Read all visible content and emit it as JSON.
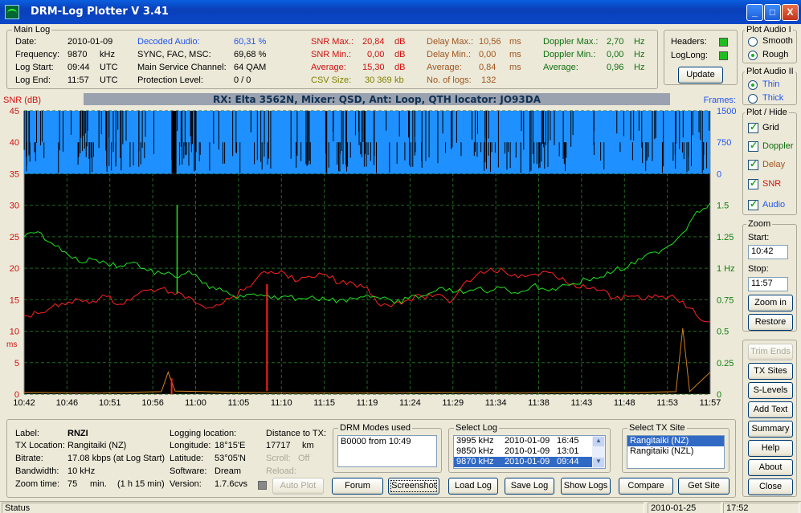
{
  "window": {
    "title": "DRM-Log Plotter  V 3.41",
    "min": "_",
    "max": "□",
    "close": "X"
  },
  "main_log": {
    "title": "Main Log",
    "date_label": "Date:",
    "date": "2010-01-09",
    "freq_label": "Frequency:",
    "freq": "9870",
    "freq_unit": "kHz",
    "start_label": "Log Start:",
    "start": "09:44",
    "start_unit": "UTC",
    "end_label": "Log End:",
    "end": "11:57",
    "end_unit": "UTC",
    "decoded_label": "Decoded Audio:",
    "decoded": "60,31 %",
    "sync_label": "SYNC, FAC, MSC:",
    "sync": "69,68 %",
    "msc_label": "Main Service Channel:",
    "msc": "64  QAM",
    "prot_label": "Protection Level:",
    "prot": "0 / 0",
    "snrmax_label": "SNR Max.:",
    "snrmax": "20,84",
    "snrmax_unit": "dB",
    "snrmin_label": "SNR Min.:",
    "snrmin": "0,00",
    "snrmin_unit": "dB",
    "snravg_label": "Average:",
    "snravg": "15,30",
    "snravg_unit": "dB",
    "csv_label": "CSV Size:",
    "csv": "30 369",
    "csv_unit": "kb",
    "dmax_label": "Delay Max.:",
    "dmax": "10,56",
    "dmax_unit": "ms",
    "dmin_label": "Delay Min.:",
    "dmin": "0,00",
    "dmin_unit": "ms",
    "davg_label": "Average:",
    "davg": "0,84",
    "davg_unit": "ms",
    "nlogs_label": "No. of logs:",
    "nlogs": "132",
    "domax_label": "Doppler Max.:",
    "domax": "2,70",
    "domax_unit": "Hz",
    "domin_label": "Doppler Min.:",
    "domin": "0,00",
    "domin_unit": "Hz",
    "doavg_label": "Average:",
    "doavg": "0,96",
    "doavg_unit": "Hz"
  },
  "headers_box": {
    "headers_label": "Headers:",
    "loglong_label": "LogLong:",
    "update": "Update"
  },
  "plot_audio1": {
    "title": "Plot Audio I",
    "smooth": "Smooth",
    "rough": "Rough"
  },
  "plot_audio2": {
    "title": "Plot Audio II",
    "thin": "Thin",
    "thick": "Thick"
  },
  "plot_hide": {
    "title": "Plot / Hide",
    "grid": "Grid",
    "doppler": "Doppler",
    "delay": "Delay",
    "snr": "SNR",
    "audio": "Audio"
  },
  "zoom": {
    "title": "Zoom",
    "start_label": "Start:",
    "start": "10:42",
    "stop_label": "Stop:",
    "stop": "11:57",
    "zoom_in": "Zoom in",
    "restore": "Restore"
  },
  "side_buttons": {
    "trim": "Trim Ends",
    "tx_sites": "TX Sites",
    "s_levels": "S-Levels",
    "add_text": "Add Text",
    "summary": "Summary",
    "help": "Help",
    "about": "About",
    "close": "Close"
  },
  "chart_data": {
    "type": "line",
    "title": "RX: Elta 3562N, Mixer: QSD,  Ant: Loop, QTH locator: JO93DA",
    "left_axis_label": "SNR (dB)",
    "left_axis_label2": "ms",
    "right_axis_label": "Frames:",
    "x_ticks": [
      "10:42",
      "10:46",
      "10:51",
      "10:56",
      "11:00",
      "11:05",
      "11:10",
      "11:15",
      "11:19",
      "11:24",
      "11:29",
      "11:34",
      "11:38",
      "11:43",
      "11:48",
      "11:53",
      "11:57"
    ],
    "y_ticks_left": [
      "45",
      "40",
      "35",
      "30",
      "25",
      "20",
      "15",
      "10",
      "5",
      "0"
    ],
    "frames_ticks": [
      "1500",
      "750",
      "0"
    ],
    "doppler_ticks": [
      "1.5",
      "1.25",
      "1 Hz",
      "0.75",
      "0.5",
      "0.25",
      "0"
    ],
    "ylim": [
      0,
      45
    ],
    "grid": true,
    "series": [
      {
        "kind": "snr",
        "color": "#ff2020",
        "x": [
          0,
          2,
          4,
          6,
          8,
          10,
          12,
          14,
          16,
          18,
          20,
          22,
          24,
          26,
          28,
          30,
          32,
          34,
          36,
          38,
          40,
          42,
          44,
          46,
          48,
          50,
          52,
          54,
          56,
          58,
          60,
          62,
          64,
          66,
          68,
          70,
          72,
          74,
          76,
          78,
          80,
          82,
          84,
          86,
          88,
          90,
          92,
          94,
          96,
          98,
          100
        ],
        "y": [
          12.5,
          12.8,
          13.8,
          14.2,
          15.0,
          14.8,
          15.5,
          14.3,
          15.5,
          16.5,
          16.8,
          15.8,
          15.5,
          14.0,
          14.2,
          15.2,
          16.5,
          18.5,
          19.5,
          19.2,
          18.0,
          18.5,
          19.0,
          17.6,
          17.6,
          17.0,
          14.0,
          14.5,
          15.0,
          15.5,
          15.8,
          14.5,
          17.5,
          19.0,
          20.0,
          19.5,
          18.5,
          19.0,
          19.5,
          18.2,
          17.5,
          16.8,
          16.5,
          15.2,
          15.5,
          15.0,
          15.8,
          15.5,
          14.8,
          12.5,
          11.5
        ]
      },
      {
        "kind": "doppler",
        "color": "#20e020",
        "x": [
          0,
          2,
          4,
          6,
          8,
          10,
          12,
          14,
          16,
          18,
          20,
          22,
          24,
          26,
          28,
          30,
          32,
          34,
          36,
          38,
          40,
          42,
          44,
          46,
          48,
          50,
          52,
          54,
          56,
          58,
          60,
          62,
          64,
          66,
          68,
          70,
          72,
          74,
          76,
          78,
          80,
          82,
          84,
          86,
          88,
          90,
          92,
          94,
          96,
          98,
          100
        ],
        "y": [
          1.25,
          1.29,
          1.2,
          1.13,
          1.05,
          1.07,
          1.04,
          1.02,
          1.05,
          0.98,
          0.96,
          0.93,
          0.98,
          0.88,
          0.83,
          0.79,
          0.77,
          0.78,
          0.76,
          0.78,
          0.76,
          0.78,
          0.75,
          0.75,
          0.76,
          0.79,
          0.76,
          0.72,
          0.76,
          0.78,
          0.82,
          0.84,
          0.8,
          0.84,
          0.82,
          0.85,
          0.8,
          0.86,
          0.83,
          0.85,
          0.88,
          0.91,
          0.93,
          0.98,
          1.01,
          1.07,
          1.13,
          1.18,
          1.28,
          1.45,
          1.52
        ]
      },
      {
        "kind": "delay",
        "color": "#d08020",
        "x": [
          0,
          10,
          20,
          21,
          22,
          30,
          40,
          50,
          60,
          70,
          80,
          90,
          95,
          96,
          97,
          100
        ],
        "y": [
          0.3,
          0.2,
          0.4,
          3.5,
          0.5,
          0.3,
          0.2,
          0.2,
          0.3,
          0.2,
          0.3,
          0.3,
          0.4,
          10.5,
          0.4,
          3.5
        ]
      },
      {
        "kind": "frames",
        "color": "#2090ff",
        "x": [
          0,
          100
        ],
        "y": [
          1500,
          1500
        ]
      }
    ]
  },
  "info": {
    "label_l": "Label:",
    "label": "RNZI",
    "txloc_l": "TX Location:",
    "txloc": "Rangitaiki (NZ)",
    "bitrate_l": "Bitrate:",
    "bitrate": "17.08 kbps (at Log Start)",
    "bw_l": "Bandwidth:",
    "bw": "10 kHz",
    "zoom_l": "Zoom time:",
    "zoom": "75",
    "zoom_unit": "min.",
    "zoom_hm": "(1 h 15 min)",
    "logloc_l": "Logging location:",
    "lon_l": "Longitude:",
    "lon": "18°15'E",
    "lat_l": "Latitude:",
    "lat": "53°05'N",
    "sw_l": "Software:",
    "sw": "Dream",
    "ver_l": "Version:",
    "ver": "1.7.6cvs",
    "dist_l": "Distance to TX:",
    "dist": "17717",
    "dist_unit": "km",
    "scroll_l": "Scroll:",
    "scroll": "Off",
    "reload_l": "Reload:",
    "autoplot": "Auto Plot"
  },
  "drm_modes": {
    "title": "DRM Modes used",
    "items": [
      "B0000 from 10:49"
    ]
  },
  "select_log": {
    "title": "Select Log",
    "rows": [
      {
        "freq": "3995 kHz",
        "date": "2010-01-09",
        "time": "16:45"
      },
      {
        "freq": "9850 kHz",
        "date": "2010-01-09",
        "time": "13:01"
      },
      {
        "freq": "9870 kHz",
        "date": "2010-01-09",
        "time": "09:44"
      }
    ]
  },
  "select_tx": {
    "title": "Select TX Site",
    "items": [
      "Rangitaiki (NZ)",
      "Rangitaiki (NZL)"
    ]
  },
  "bottom_buttons": {
    "forum": "Forum",
    "screenshot": "Screenshot",
    "load_log": "Load Log",
    "save_log": "Save Log",
    "show_logs": "Show Logs",
    "compare": "Compare",
    "get_site": "Get Site"
  },
  "status": {
    "text": "Status",
    "date": "2010-01-25",
    "time": "17:52"
  }
}
